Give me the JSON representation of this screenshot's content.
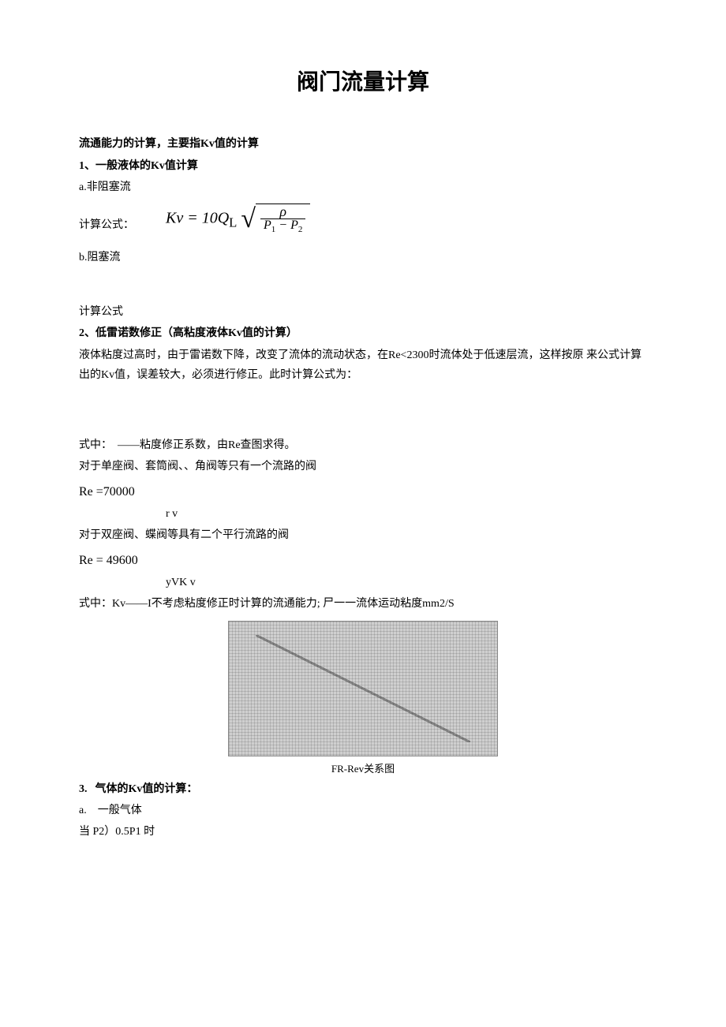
{
  "title": "阀门流量计算",
  "intro": "流通能力的计算，主要指Kv值的计算",
  "sec1": {
    "heading": "1、一般液体的Kv值计算",
    "a_label": "a.非阻塞流",
    "calc_label": "计算公式：",
    "formula_lhs": "Kν = 10Q",
    "formula_sub": "L",
    "frac_top": "ρ",
    "frac_bot_p1": "P",
    "frac_bot_s1": "1",
    "frac_bot_minus": " − ",
    "frac_bot_p2": "P",
    "frac_bot_s2": "2",
    "b_label": "b.阻塞流",
    "calc_label2": "计算公式"
  },
  "sec2": {
    "heading": "2、低雷诺数修正（高粘度液体Kv值的计算）",
    "body": "液体粘度过高时，由于雷诺数下降，改变了流体的流动状态，在Re<2300时流体处于低速层流，这样按原 来公式计算出的Kv值，误差较大，必须进行修正。此时计算公式为：",
    "note1": "式中：　——粘度修正系数，由Re查图求得。",
    "note2": "对于单座阀、套筒阀、、角阀等只有一个流路的阀",
    "re1": "Re =70000",
    "re1_sub": "r v",
    "note3": "对于双座阀、蝶阀等具有二个平行流路的阀",
    "re2": "Re = 49600",
    "re2_sub": "yVK v",
    "note4": "式中：Kv——I不考虑粘度修正时计算的流通能力; 尸一一流体运动粘度mm2/S",
    "chart_caption": "FR-Rev关系图"
  },
  "sec3": {
    "num": "3.",
    "heading": "气体的Kv值的计算：",
    "a_label": "a. 一般气体",
    "cond": "当 P2）0.5P1 时"
  }
}
